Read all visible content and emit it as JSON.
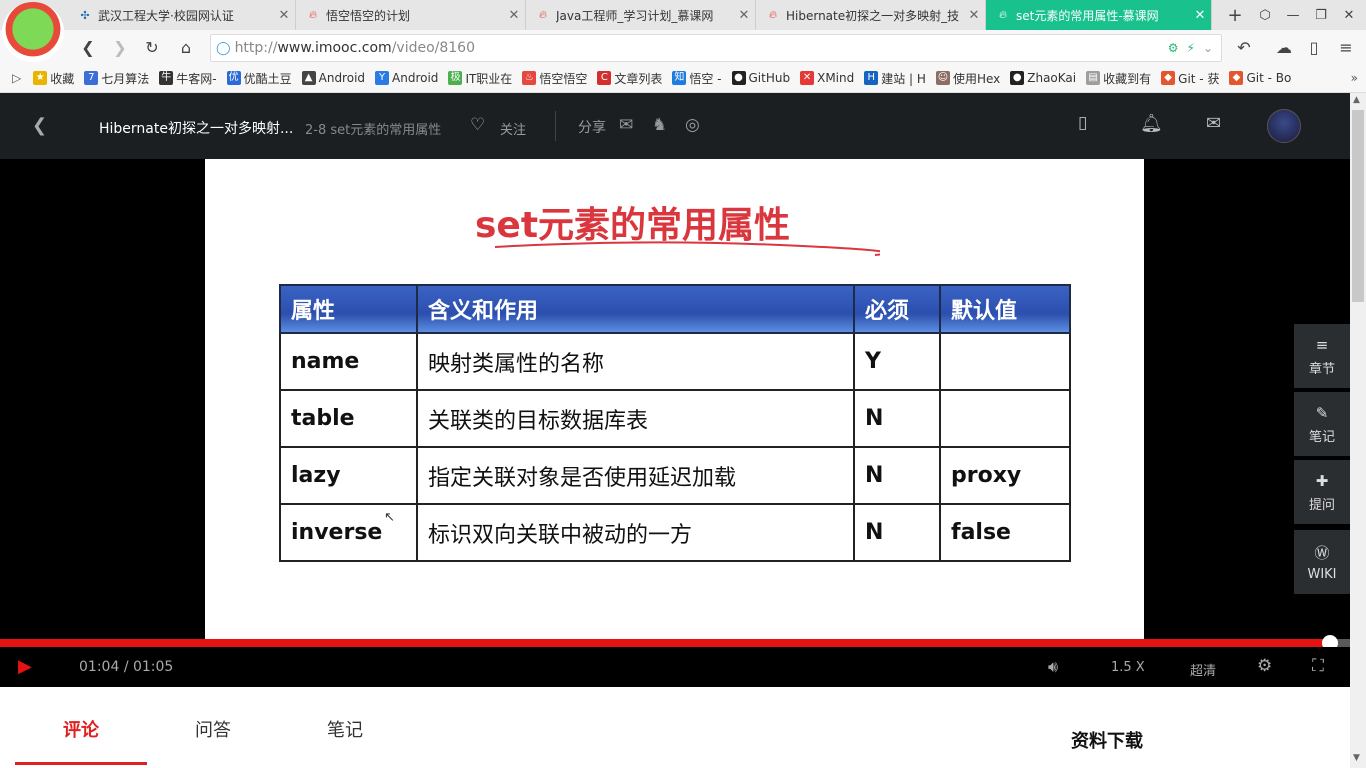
{
  "browser": {
    "tabs": [
      {
        "label": "武汉工程大学·校园网认证",
        "icon": "network-icon",
        "active": false
      },
      {
        "label": "悟空悟空的计划",
        "icon": "flame-icon",
        "active": false
      },
      {
        "label": "Java工程师_学习计划_慕课网",
        "icon": "flame-icon",
        "active": false
      },
      {
        "label": "Hibernate初探之一对多映射_技",
        "icon": "flame-icon",
        "active": false
      },
      {
        "label": "set元素的常用属性-慕课网",
        "icon": "flame-icon",
        "active": true
      }
    ],
    "new_tab": "+",
    "url_prefix": "http://",
    "url_domain": "www.imooc.com",
    "url_path": "/video/8160"
  },
  "bookmarks": [
    {
      "label": "收藏",
      "icon": "star-icon",
      "color": "#e8b400"
    },
    {
      "label": "七月算法",
      "icon": "seven-icon",
      "color": "#3a6fd8"
    },
    {
      "label": "牛客网-",
      "icon": "niuke-icon",
      "color": "#333333"
    },
    {
      "label": "优酷土豆",
      "icon": "youku-icon",
      "color": "#2a6bd8"
    },
    {
      "label": "Android",
      "icon": "android-icon",
      "color": "#444444"
    },
    {
      "label": "Android",
      "icon": "y-icon",
      "color": "#2c7be5"
    },
    {
      "label": "IT职业在",
      "icon": "ji-icon",
      "color": "#4caf50"
    },
    {
      "label": "悟空悟空",
      "icon": "flame-icon",
      "color": "#e5483d"
    },
    {
      "label": "文章列表",
      "icon": "c-icon",
      "color": "#d32f2f"
    },
    {
      "label": "悟空 -",
      "icon": "zhihu-icon",
      "color": "#1e7be0"
    },
    {
      "label": "GitHub",
      "icon": "github-icon",
      "color": "#222222"
    },
    {
      "label": "XMind",
      "icon": "xmind-icon",
      "color": "#e53935"
    },
    {
      "label": "建站 | H",
      "icon": "h-icon",
      "color": "#1565c0"
    },
    {
      "label": "使用Hex",
      "icon": "avatar-icon",
      "color": "#8d6e63"
    },
    {
      "label": "ZhaoKai",
      "icon": "github-icon",
      "color": "#222222"
    },
    {
      "label": "收藏到有",
      "icon": "doc-icon",
      "color": "#9e9e9e"
    },
    {
      "label": "Git - 获",
      "icon": "git-icon",
      "color": "#e4572e"
    },
    {
      "label": "Git - Bo",
      "icon": "git-icon",
      "color": "#e4572e"
    }
  ],
  "header": {
    "course_title": "Hibernate初探之一对多映射...",
    "section": "2-8 set元素的常用属性",
    "follow": "关注",
    "share": "分享"
  },
  "slide": {
    "title": "set元素的常用属性",
    "columns": [
      "属性",
      "含义和作用",
      "必须",
      "默认值"
    ],
    "rows": [
      [
        "name",
        "映射类属性的名称",
        "Y",
        ""
      ],
      [
        "table",
        "关联类的目标数据库表",
        "N",
        ""
      ],
      [
        "lazy",
        "指定关联对象是否使用延迟加载",
        "N",
        "proxy"
      ],
      [
        "inverse",
        "标识双向关联中被动的一方",
        "N",
        "false"
      ]
    ]
  },
  "side_tools": [
    {
      "label": "章节",
      "icon": "menu-icon"
    },
    {
      "label": "笔记",
      "icon": "pencil-icon"
    },
    {
      "label": "提问",
      "icon": "question-icon"
    },
    {
      "label": "WIKI",
      "icon": "wiki-icon"
    }
  ],
  "player": {
    "current_time": "01:04",
    "separator": "/",
    "duration": "01:05",
    "progress": 0.985,
    "speed": "1.5 X",
    "quality": "超清"
  },
  "bottom": {
    "tabs": [
      "评论",
      "问答",
      "笔记"
    ],
    "active_tab": 0,
    "materials": "资料下载"
  },
  "colors": {
    "accent_green": "#19c28d",
    "progress_red": "#e5130f",
    "active_tab_red": "#e02020"
  }
}
